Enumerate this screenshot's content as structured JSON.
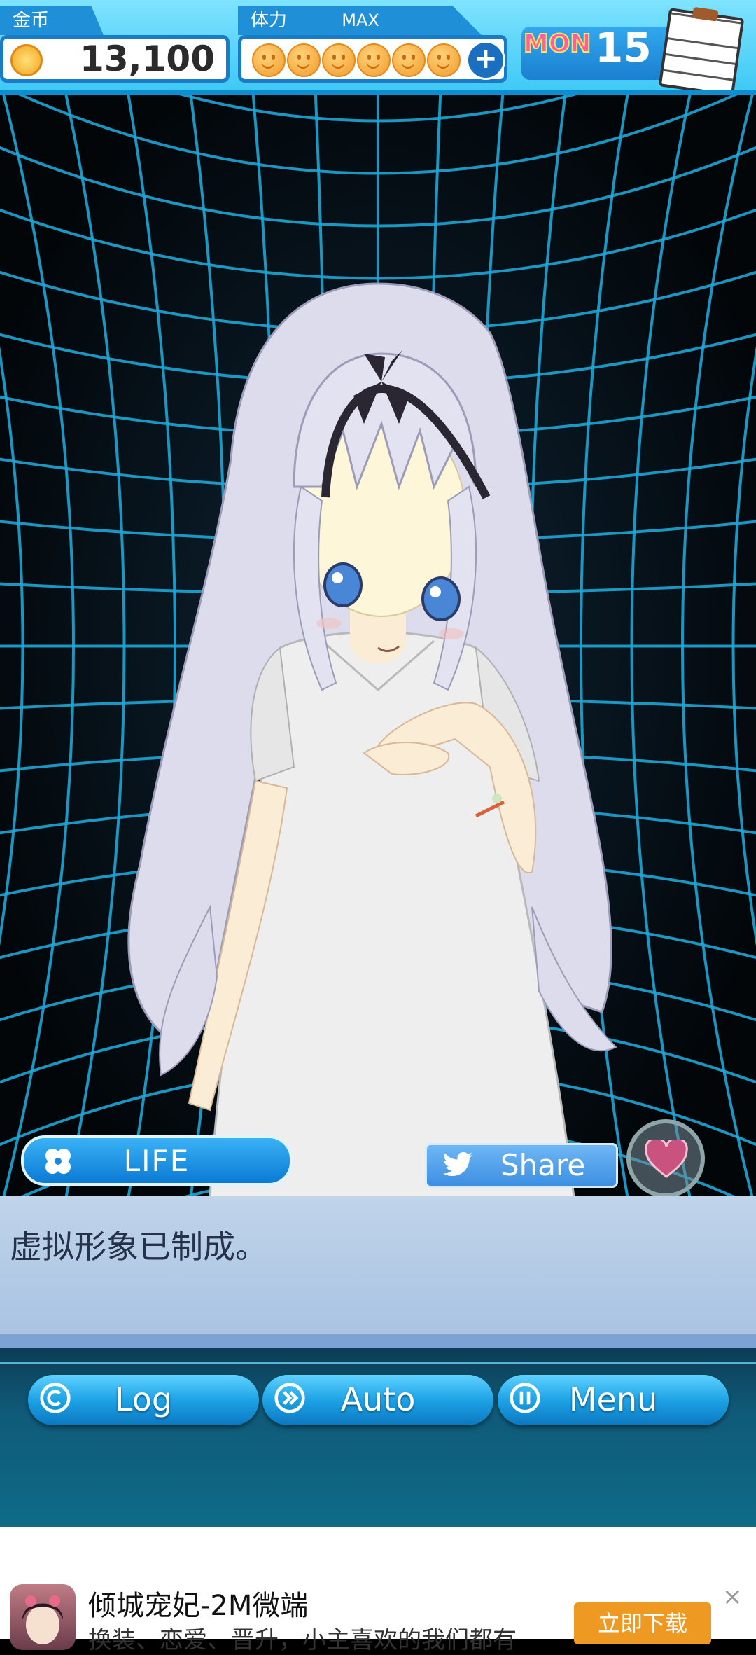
{
  "hud": {
    "coin_label": "金币",
    "coin_value": "13,100",
    "stamina_label": "体力",
    "stamina_max": "MAX",
    "stamina_count": 6,
    "plus": "+",
    "month": "MON",
    "day": "15"
  },
  "stage": {
    "life_label": "LIFE",
    "share_label": "Share"
  },
  "dialog": {
    "text": "虚拟形象已制成。"
  },
  "controls": {
    "log_label": "Log",
    "auto_label": "Auto",
    "menu_label": "Menu"
  },
  "ad": {
    "title": "倾城宠妃-2M微端",
    "description": "换装、恋爱、晋升，小主喜欢的我们都有",
    "button_label": "立即下载",
    "close": "×"
  },
  "colors": {
    "grid": "#1ea6d6",
    "accent_blue": "#1da3e6",
    "ad_button": "#ee9a22"
  }
}
